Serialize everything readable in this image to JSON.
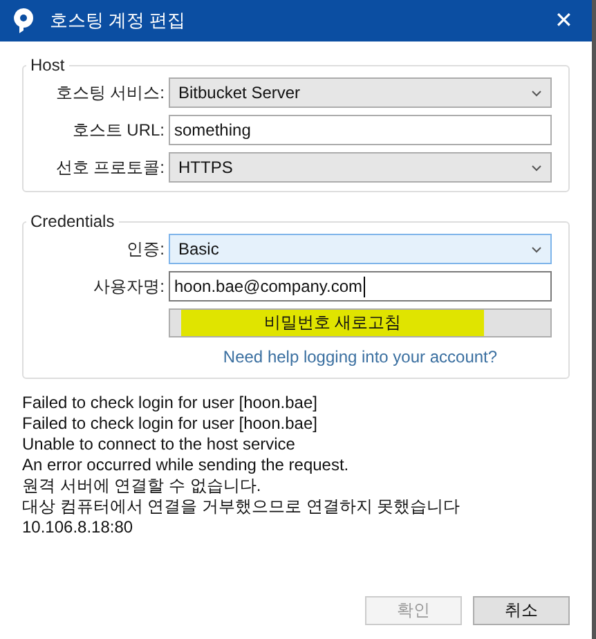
{
  "window": {
    "title": "호스팅 계정 편집",
    "close": "✕"
  },
  "groups": [
    {
      "title": "Host",
      "rows": [
        {
          "label": "호스팅 서비스:",
          "kind": "select",
          "value": "Bitbucket Server",
          "hovered": false
        },
        {
          "label": "호스트 URL:",
          "kind": "text",
          "value": "something",
          "focused": false
        },
        {
          "label": "선호 프로토콜:",
          "kind": "select",
          "value": "HTTPS",
          "hovered": false
        }
      ]
    },
    {
      "title": "Credentials",
      "rows": [
        {
          "label": "인증:",
          "kind": "select",
          "value": "Basic",
          "hovered": true
        },
        {
          "label": "사용자명:",
          "kind": "text",
          "value": "hoon.bae@company.com",
          "focused": true
        },
        {
          "kind": "button",
          "value": "비밀번호 새로고침",
          "highlighted": true
        },
        {
          "kind": "link",
          "value": "Need help logging into your account?"
        }
      ]
    }
  ],
  "log": [
    "Failed to check login for user [hoon.bae]",
    "Failed to check login for user [hoon.bae]",
    "Unable to connect to the host service",
    "An error occurred while sending the request.",
    "원격 서버에 연결할 수 없습니다.",
    "대상 컴퓨터에서 연결을 거부했으므로 연결하지 못했습니다",
    "10.106.8.18:80"
  ],
  "buttons": [
    {
      "label": "확인",
      "disabled": true
    },
    {
      "label": "취소",
      "disabled": false
    }
  ]
}
